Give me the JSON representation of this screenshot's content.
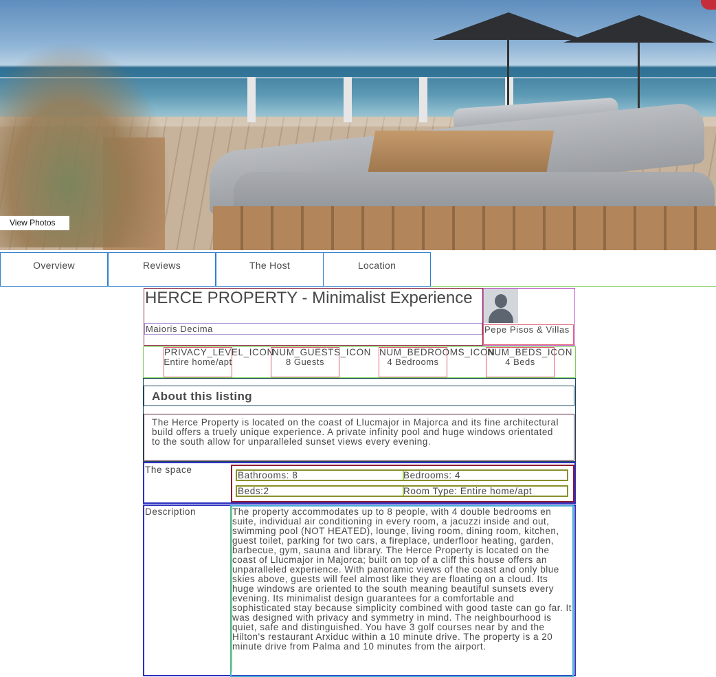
{
  "hero": {
    "view_photos_label": "View Photos"
  },
  "tabs": [
    {
      "label": "Overview"
    },
    {
      "label": "Reviews"
    },
    {
      "label": "The Host"
    },
    {
      "label": "Location"
    }
  ],
  "listing": {
    "title": "HERCE PROPERTY - Minimalist Experience",
    "location": "Maioris Decima"
  },
  "host": {
    "name": "Pepe Pisos & Villas"
  },
  "summary": [
    {
      "icon_label": "PRIVACY_LEVEL_ICON",
      "value": "Entire home/apt"
    },
    {
      "icon_label": "NUM_GUESTS_ICON",
      "value": "8 Guests"
    },
    {
      "icon_label": "NUM_BEDROOMS_ICON",
      "value": "4 Bedrooms"
    },
    {
      "icon_label": "NUM_BEDS_ICON",
      "value": "4 Beds"
    }
  ],
  "about": {
    "heading": "About this listing",
    "text": "The Herce Property is located on the coast of Llucmajor in Majorca and its fine architectural build offers a truely unique experience. A private infinity pool and huge windows orientated to the south allow for unparalleled sunset views every evening."
  },
  "space": {
    "label": "The space",
    "rows": [
      [
        "Bathrooms: 8",
        "Bedrooms: 4"
      ],
      [
        "Beds:2",
        "Room Type: Entire home/apt"
      ]
    ]
  },
  "description": {
    "label": "Description",
    "text": "The property accommodates up to 8 people, with 4 double bedrooms en suite, individual air conditioning in every room, a jacuzzi inside and out, swimming pool (NOT HEATED), lounge, living room, dining room, kitchen, guest toilet, parking for two cars, a fireplace, underfloor heating, garden, barbecue, gym, sauna and library. The Herce Property is located on the coast of Llucmajor in Majorca; built on top of a cliff this house offers an unparalleled experience. With panoramic views of the coast and only blue skies above, guests will feel almost like they are floating on a cloud. Its huge windows are oriented to the south meaning beautiful sunsets every evening. Its minimalist design guarantees for a comfortable and sophisticated stay because simplicity combined with good taste can go far. It was designed with privacy and symmetry in mind. The neighbourhood is quiet, safe and distinguished. You have 3 golf courses near by and the Hilton's restaurant Arxiduc within a 10 minute drive. The property is a 20 minute drive from Palma and 10 minutes from the airport."
  }
}
